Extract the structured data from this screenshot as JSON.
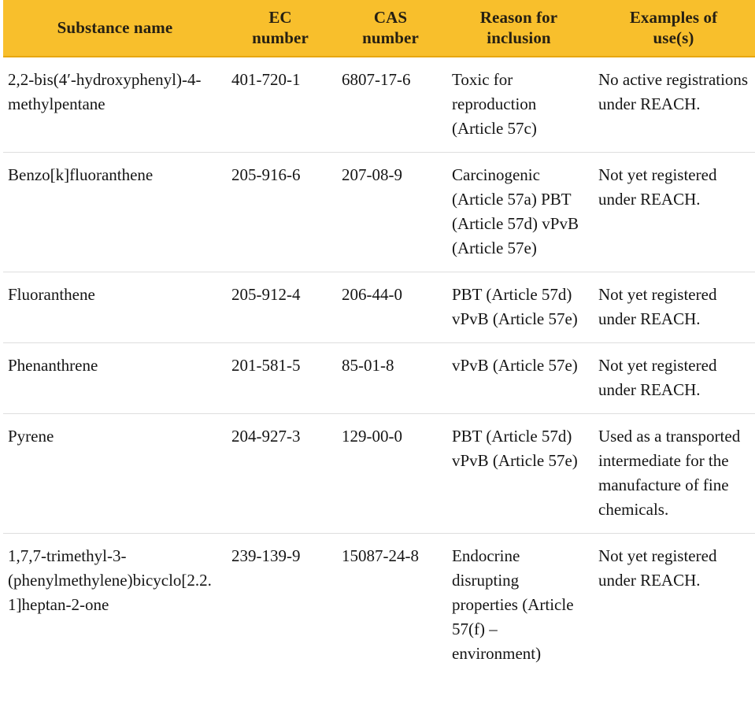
{
  "table": {
    "columns": [
      {
        "id": "substance",
        "label_lines": [
          "Substance name"
        ],
        "label": "Substance name"
      },
      {
        "id": "ec",
        "label_lines": [
          "EC",
          "number"
        ],
        "label": "EC number"
      },
      {
        "id": "cas",
        "label_lines": [
          "CAS",
          "number"
        ],
        "label": "CAS number"
      },
      {
        "id": "reason",
        "label_lines": [
          "Reason for",
          "inclusion"
        ],
        "label": "Reason for inclusion"
      },
      {
        "id": "examples",
        "label_lines": [
          "Examples of",
          "use(s)"
        ],
        "label": "Examples of use(s)"
      }
    ],
    "header_background": "#f8bf2c",
    "header_text_color": "#262013",
    "row_divider_color": "#dedede",
    "rows": [
      {
        "substance": "2,2-bis(4′-hydroxyphenyl)-4-methylpentane",
        "ec": "401-720-1",
        "cas": "6807-17-6",
        "reason": "Toxic for reproduction (Article 57c)",
        "examples": "No active registrations under REACH."
      },
      {
        "substance": "Benzo[k]fluoranthene",
        "ec": "205-916-6",
        "cas": "207-08-9",
        "reason": "Carcinogenic (Article 57a) PBT (Article 57d) vPvB (Article 57e)",
        "examples": "Not yet registered under REACH."
      },
      {
        "substance": "Fluoranthene",
        "ec": "205-912-4",
        "cas": "206-44-0",
        "reason": "PBT (Article 57d) vPvB (Article 57e)",
        "examples": "Not yet registered under REACH."
      },
      {
        "substance": "Phenanthrene",
        "ec": "201-581-5",
        "cas": "85-01-8",
        "reason": "vPvB (Article 57e)",
        "examples": "Not yet registered under REACH."
      },
      {
        "substance": "Pyrene",
        "ec": "204-927-3",
        "cas": "129-00-0",
        "reason": "PBT (Article 57d) vPvB (Article 57e)",
        "examples": "Used as a transported intermediate for the manufacture of fine chemicals."
      },
      {
        "substance": "1,7,7-trimethyl-3-(phenylmethylene)bicyclo[2.2.1]heptan-2-one",
        "ec": "239-139-9",
        "cas": "15087-24-8",
        "reason": "Endocrine disrupting properties (Article 57(f) – environment)",
        "examples": "Not yet registered under REACH."
      }
    ]
  }
}
